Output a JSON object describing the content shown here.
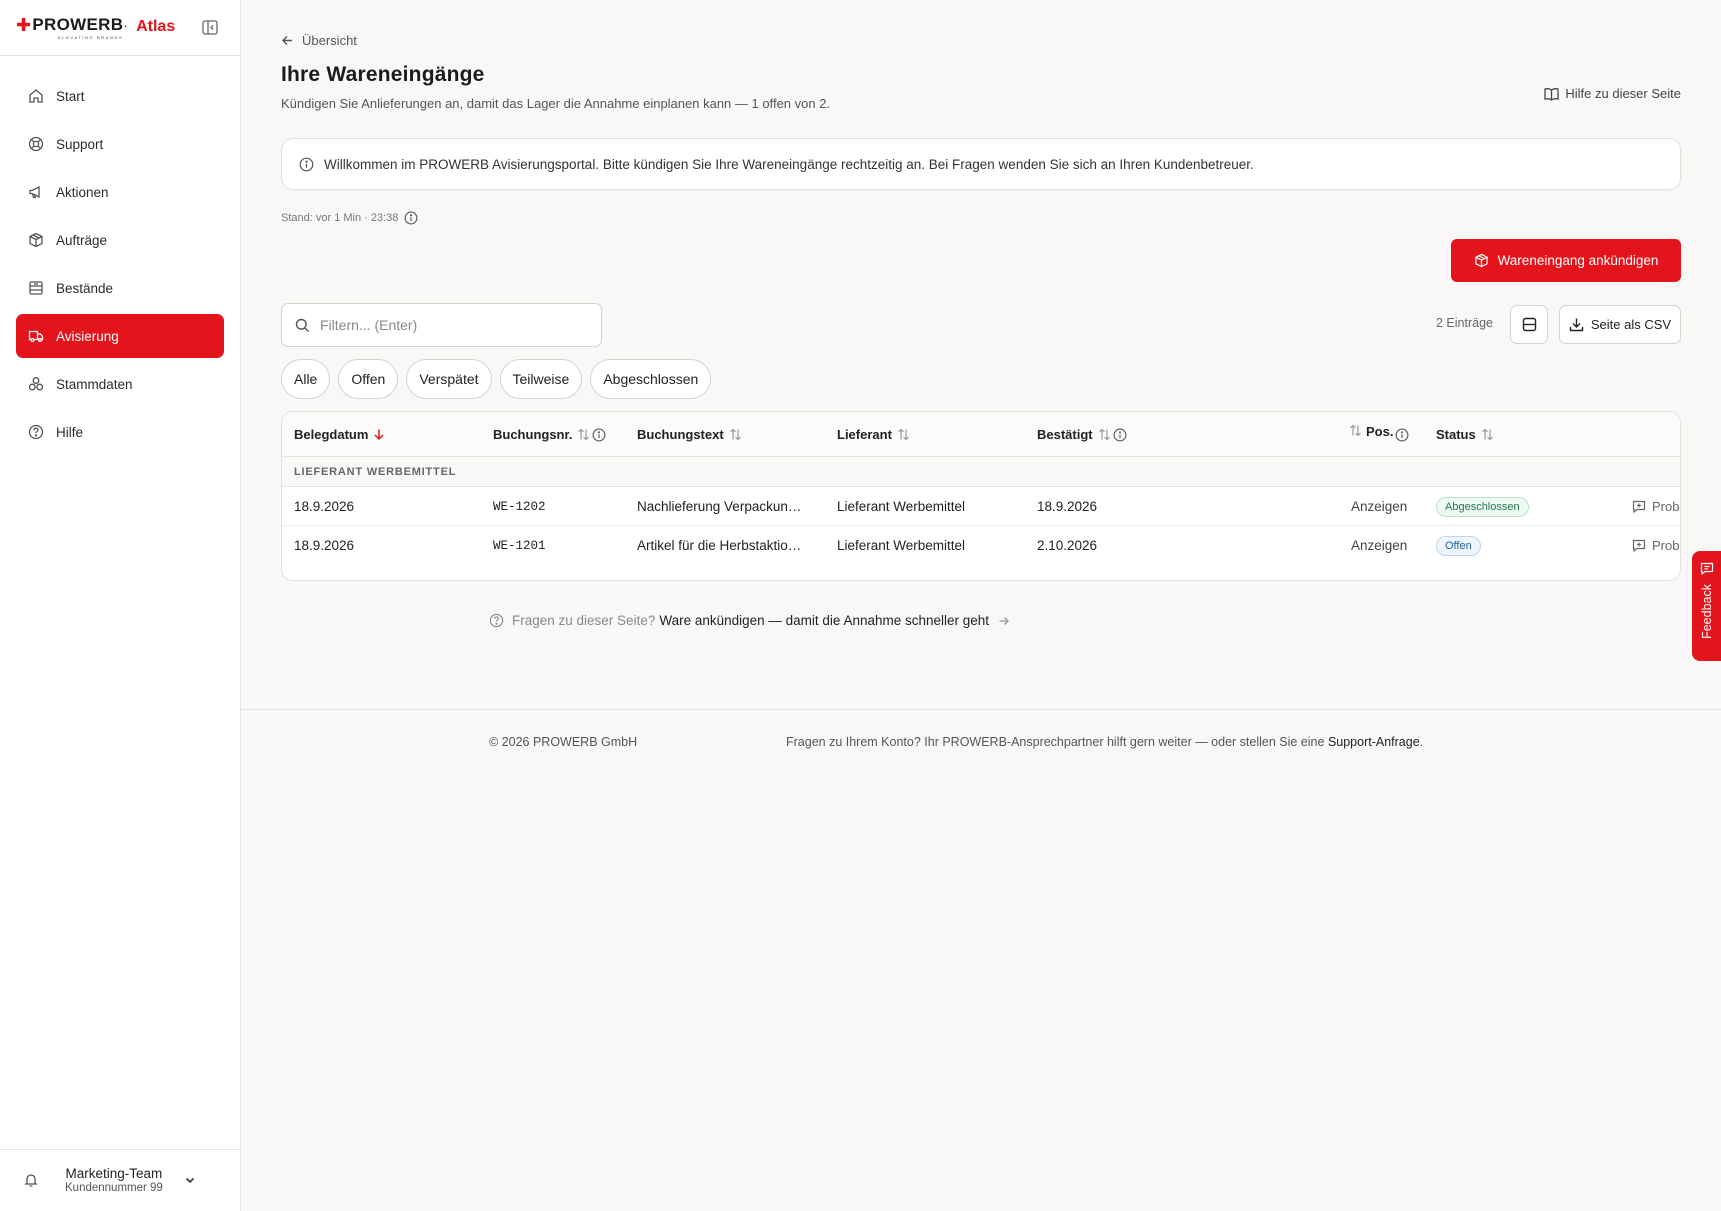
{
  "brand": {
    "logo_text": "PROWERB",
    "logo_sup": ".",
    "tagline": "ELEVATING BRANDS",
    "app_name": "Atlas"
  },
  "sidebar": {
    "items": [
      {
        "label": "Start",
        "icon": "home-icon"
      },
      {
        "label": "Support",
        "icon": "lifebuoy-icon"
      },
      {
        "label": "Aktionen",
        "icon": "megaphone-icon"
      },
      {
        "label": "Aufträge",
        "icon": "package-icon"
      },
      {
        "label": "Bestände",
        "icon": "inventory-icon"
      },
      {
        "label": "Avisierung",
        "icon": "truck-icon",
        "active": true
      },
      {
        "label": "Stammdaten",
        "icon": "boxes-icon"
      },
      {
        "label": "Hilfe",
        "icon": "help-circle-icon"
      }
    ]
  },
  "account": {
    "name": "Marketing-Team",
    "customer_number": "Kundennummer 99"
  },
  "header": {
    "back_label": "Übersicht",
    "title": "Ihre Wareneingänge",
    "subtitle": "Kündigen Sie Anlieferungen an, damit das Lager die Annahme einplanen kann — 1 offen von 2.",
    "help_label": "Hilfe zu dieser Seite"
  },
  "banner": {
    "text": "Willkommen im PROWERB Avisierungsportal. Bitte kündigen Sie Ihre Wareneingänge rechtzeitig an. Bei Fragen wenden Sie sich an Ihren Kundenbetreuer."
  },
  "status_line": {
    "text": "Stand: vor 1 Min · 23:38"
  },
  "actions": {
    "announce_label": "Wareneingang ankündigen",
    "csv_label": "Seite als CSV",
    "entries_count": "2 Einträge"
  },
  "search": {
    "placeholder": "Filtern... (Enter)",
    "value": ""
  },
  "filters": [
    "Alle",
    "Offen",
    "Verspätet",
    "Teilweise",
    "Abgeschlossen"
  ],
  "table": {
    "columns": {
      "belegdatum": "Belegdatum",
      "buchungsnr": "Buchungsnr.",
      "buchungstext": "Buchungstext",
      "lieferant": "Lieferant",
      "bestaetigt": "Bestätigt",
      "pos": "Pos.",
      "status": "Status"
    },
    "group_label": "LIEFERANT WERBEMITTEL",
    "rows": [
      {
        "belegdatum": "18.9.2026",
        "buchungsnr": "WE-1202",
        "buchungstext": "Nachlieferung Verpackun…",
        "lieferant": "Lieferant Werbemittel",
        "bestaetigt": "18.9.2026",
        "pos": "Anzeigen",
        "status": "Abgeschlossen",
        "status_kind": "done",
        "action": "Prob"
      },
      {
        "belegdatum": "18.9.2026",
        "buchungsnr": "WE-1201",
        "buchungstext": "Artikel für die Herbstaktio…",
        "lieferant": "Lieferant Werbemittel",
        "bestaetigt": "2.10.2026",
        "pos": "Anzeigen",
        "status": "Offen",
        "status_kind": "open",
        "action": "Prob"
      }
    ]
  },
  "faq": {
    "prefix": "Fragen zu dieser Seite?",
    "link": "Ware ankündigen — damit die Annahme schneller geht"
  },
  "footer": {
    "copyright": "© 2026 PROWERB GmbH",
    "text": "Fragen zu Ihrem Konto? Ihr PROWERB-Ansprechpartner hilft gern weiter — oder stellen Sie eine",
    "link": "Support-Anfrage",
    "suffix": "."
  },
  "feedback": {
    "label": "Feedback"
  },
  "colors": {
    "accent": "#e3141b",
    "background": "#f9f8f6",
    "done": "#1f7a4c",
    "open": "#1d5fa0"
  }
}
